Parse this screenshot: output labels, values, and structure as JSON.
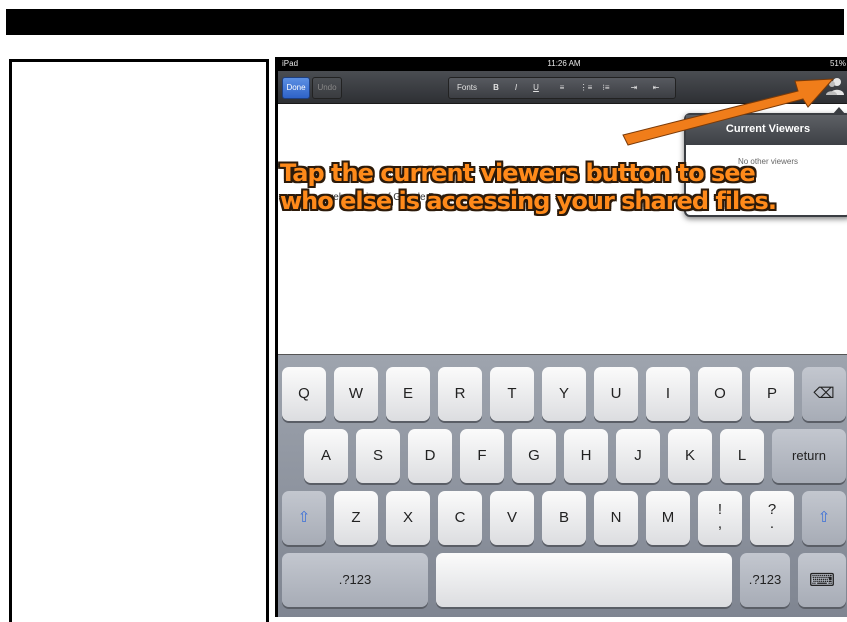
{
  "status_bar": {
    "carrier": "iPad",
    "time": "11:26 AM",
    "battery": "51%"
  },
  "toolbar": {
    "done_label": "Done",
    "undo_label": "Undo",
    "format_items": [
      "Fonts",
      "B",
      "I",
      "U",
      "≡",
      "⋮≡",
      "⁝≡",
      "⇥",
      "⇤"
    ]
  },
  "document": {
    "visible_text": "web version of Google Docs."
  },
  "popover": {
    "title": "Current Viewers",
    "body": "No other viewers"
  },
  "annotation": {
    "line1": "Tap the current viewers button to see",
    "line2": "who else is accessing your shared files."
  },
  "keyboard": {
    "row1": [
      "Q",
      "W",
      "E",
      "R",
      "T",
      "Y",
      "U",
      "I",
      "O",
      "P"
    ],
    "row2": [
      "A",
      "S",
      "D",
      "F",
      "G",
      "H",
      "J",
      "K",
      "L"
    ],
    "row3": [
      "Z",
      "X",
      "C",
      "V",
      "B",
      "N",
      "M"
    ],
    "backspace_glyph": "⌫",
    "return_label": "return",
    "shift_glyph": "⇧",
    "exclaim_top": "!",
    "exclaim_bottom": ",",
    "question_top": "?",
    "question_bottom": ".",
    "numbers_label": ".?123",
    "keyboard_glyph": "⌨"
  },
  "colors": {
    "annotation": "#ff8a1a",
    "done_button": "#2f63c8",
    "arrow": "#f07d1a"
  }
}
